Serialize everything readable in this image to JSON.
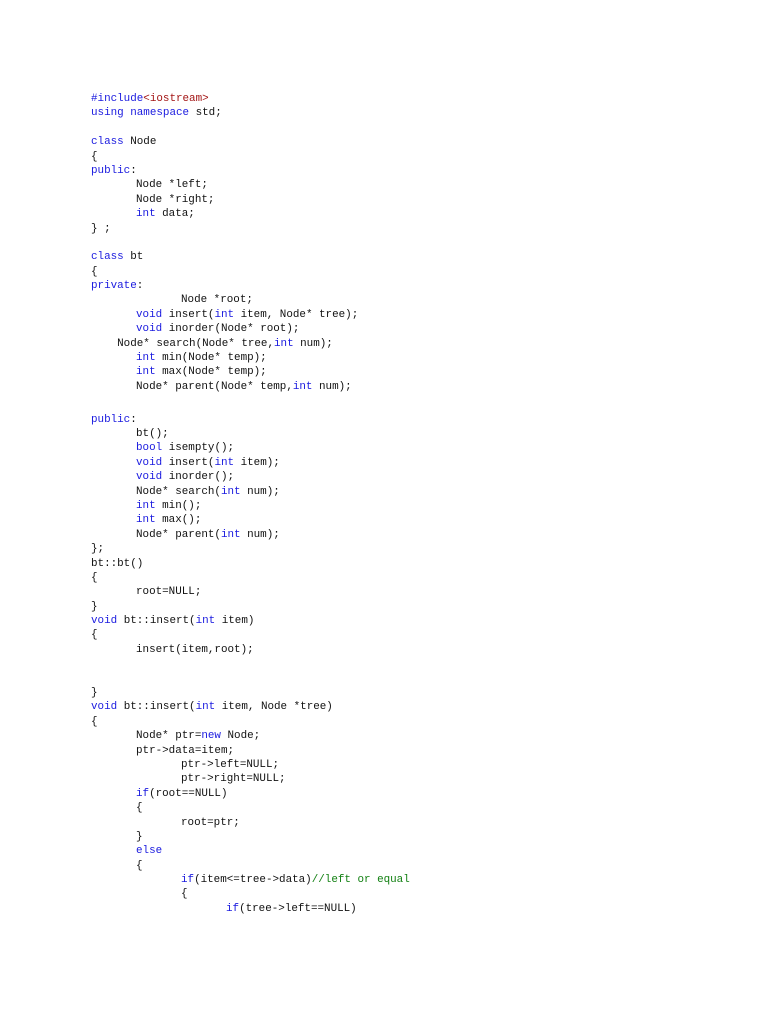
{
  "document": {
    "lines": [
      [
        [
          "#include",
          "k"
        ],
        [
          "<iostream>",
          "s"
        ]
      ],
      [
        [
          "using",
          "k"
        ],
        [
          " ",
          ""
        ],
        [
          "namespace",
          "k"
        ],
        [
          " std;",
          ""
        ]
      ],
      [],
      [
        [
          "class",
          "k"
        ],
        [
          " Node",
          ""
        ]
      ],
      [
        [
          "{",
          ""
        ]
      ],
      [
        [
          "public",
          "k"
        ],
        [
          ":",
          ""
        ]
      ],
      [
        [
          "\tNode *left;",
          ""
        ]
      ],
      [
        [
          "\tNode *right;",
          ""
        ]
      ],
      [
        [
          "\t",
          ""
        ],
        [
          "int",
          "k"
        ],
        [
          " data;",
          ""
        ]
      ],
      [
        [
          "} ;",
          ""
        ]
      ],
      [],
      [
        [
          "class",
          "k"
        ],
        [
          " bt",
          ""
        ]
      ],
      [
        [
          "{",
          ""
        ]
      ],
      [
        [
          "private",
          "k"
        ],
        [
          ":",
          ""
        ]
      ],
      [
        [
          "\t\tNode *root;",
          ""
        ]
      ],
      [
        [
          "\t",
          ""
        ],
        [
          "void",
          "k"
        ],
        [
          " insert(",
          ""
        ],
        [
          "int",
          "k"
        ],
        [
          " item, Node* tree);",
          ""
        ]
      ],
      [
        [
          "\t",
          ""
        ],
        [
          "void",
          "k"
        ],
        [
          " inorder(Node* root);",
          ""
        ]
      ],
      [
        [
          "    Node* search(Node* tree,",
          ""
        ],
        [
          "int",
          "k"
        ],
        [
          " num);",
          ""
        ]
      ],
      [
        [
          "\t",
          ""
        ],
        [
          "int",
          "k"
        ],
        [
          " min(Node* temp);",
          ""
        ]
      ],
      [
        [
          "\t",
          ""
        ],
        [
          "int",
          "k"
        ],
        [
          " max(Node* temp);",
          ""
        ]
      ],
      [
        [
          "\tNode* parent(Node* temp,",
          ""
        ],
        [
          "int",
          "k"
        ],
        [
          " num);",
          ""
        ]
      ],
      [],
      [
        [
          "public",
          "k"
        ],
        [
          ":",
          ""
        ]
      ],
      [
        [
          "\tbt();",
          ""
        ]
      ],
      [
        [
          "\t",
          ""
        ],
        [
          "bool",
          "k"
        ],
        [
          " isempty();",
          ""
        ]
      ],
      [
        [
          "\t",
          ""
        ],
        [
          "void",
          "k"
        ],
        [
          " insert(",
          ""
        ],
        [
          "int",
          "k"
        ],
        [
          " item);",
          ""
        ]
      ],
      [
        [
          "\t",
          ""
        ],
        [
          "void",
          "k"
        ],
        [
          " inorder();",
          ""
        ]
      ],
      [
        [
          "\tNode* search(",
          ""
        ],
        [
          "int",
          "k"
        ],
        [
          " num);",
          ""
        ]
      ],
      [
        [
          "\t",
          ""
        ],
        [
          "int",
          "k"
        ],
        [
          " min();",
          ""
        ]
      ],
      [
        [
          "\t",
          ""
        ],
        [
          "int",
          "k"
        ],
        [
          " max();",
          ""
        ]
      ],
      [
        [
          "\tNode* parent(",
          ""
        ],
        [
          "int",
          "k"
        ],
        [
          " num);",
          ""
        ]
      ],
      [
        [
          "};",
          ""
        ]
      ],
      [
        [
          "bt::bt()",
          ""
        ]
      ],
      [
        [
          "{",
          ""
        ]
      ],
      [
        [
          "\troot=NULL;",
          ""
        ]
      ],
      [
        [
          "}",
          ""
        ]
      ],
      [
        [
          "void",
          "k"
        ],
        [
          " bt::insert(",
          ""
        ],
        [
          "int",
          "k"
        ],
        [
          " item)",
          ""
        ]
      ],
      [
        [
          "{",
          ""
        ]
      ],
      [
        [
          "\tinsert(item,root);",
          ""
        ]
      ],
      [],
      [],
      [
        [
          "}",
          ""
        ]
      ],
      [
        [
          "void",
          "k"
        ],
        [
          " bt::insert(",
          ""
        ],
        [
          "int",
          "k"
        ],
        [
          " item, Node *tree)",
          ""
        ]
      ],
      [
        [
          "{",
          ""
        ]
      ],
      [
        [
          "\tNode* ptr=",
          ""
        ],
        [
          "new",
          "k"
        ],
        [
          " Node;",
          ""
        ]
      ],
      [
        [
          "\tptr->data=item;",
          ""
        ]
      ],
      [
        [
          "\t\tptr->left=NULL;",
          ""
        ]
      ],
      [
        [
          "\t\tptr->right=NULL;",
          ""
        ]
      ],
      [
        [
          "\t",
          ""
        ],
        [
          "if",
          "k"
        ],
        [
          "(root==NULL)",
          ""
        ]
      ],
      [
        [
          "\t{",
          ""
        ]
      ],
      [
        [
          "\t\troot=ptr;",
          ""
        ]
      ],
      [
        [
          "\t}",
          ""
        ]
      ],
      [
        [
          "\t",
          ""
        ],
        [
          "else",
          "k"
        ]
      ],
      [
        [
          "\t{",
          ""
        ]
      ],
      [
        [
          "\t\t",
          ""
        ],
        [
          "if",
          "k"
        ],
        [
          "(item<=tree->data)",
          ""
        ],
        [
          "//left or equal",
          "c"
        ]
      ],
      [
        [
          "\t\t{",
          ""
        ]
      ],
      [
        [
          "\t\t\t",
          ""
        ],
        [
          "if",
          "k"
        ],
        [
          "(tree->left==NULL)",
          ""
        ]
      ]
    ]
  }
}
